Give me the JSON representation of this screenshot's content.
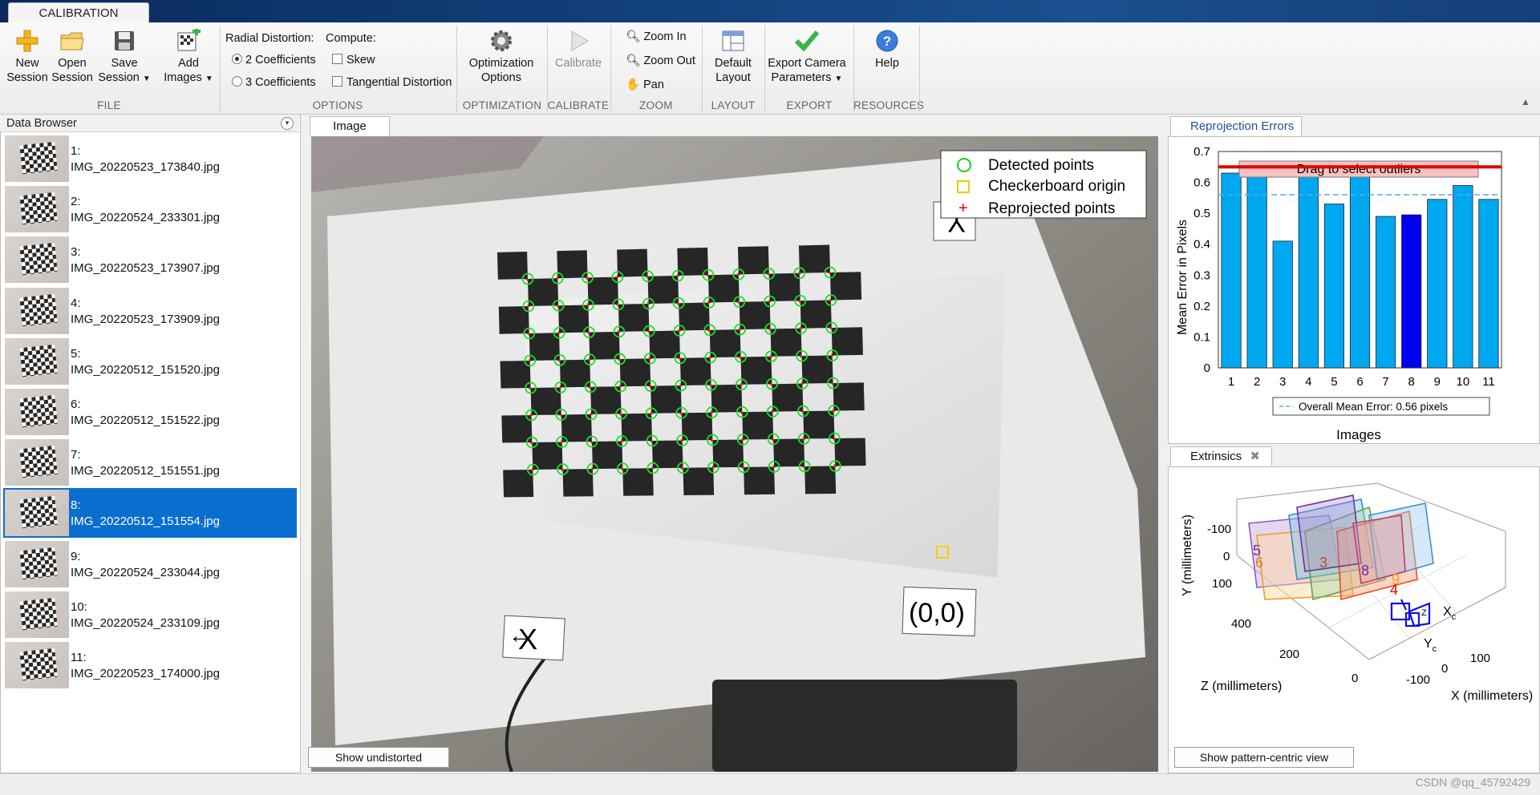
{
  "ribbon": {
    "tab": "CALIBRATION",
    "file": {
      "new_session": [
        "New",
        "Session"
      ],
      "open_session": [
        "Open",
        "Session"
      ],
      "save_session": [
        "Save",
        "Session"
      ],
      "add_images": [
        "Add",
        "Images"
      ],
      "section": "FILE"
    },
    "options": {
      "radial_label": "Radial Distortion:",
      "radial_options": [
        "2 Coefficients",
        "3 Coefficients"
      ],
      "radial_selected": "2 Coefficients",
      "compute_label": "Compute:",
      "compute_options": [
        "Skew",
        "Tangential Distortion"
      ],
      "section": "OPTIONS"
    },
    "optimization": {
      "label": [
        "Optimization",
        "Options"
      ],
      "section": "OPTIMIZATION"
    },
    "calibrate": {
      "label": "Calibrate",
      "section": "CALIBRATE"
    },
    "zoom": {
      "zoom_in": "Zoom In",
      "zoom_out": "Zoom Out",
      "pan": "Pan",
      "section": "ZOOM"
    },
    "layout": {
      "label": [
        "Default",
        "Layout"
      ],
      "section": "LAYOUT"
    },
    "export": {
      "label": [
        "Export Camera",
        "Parameters"
      ],
      "section": "EXPORT"
    },
    "resources": {
      "label": "Help",
      "section": "RESOURCES"
    }
  },
  "data_browser": {
    "title": "Data Browser",
    "selected_index": 8,
    "items": [
      {
        "num": "1:",
        "name": "IMG_20220523_173840.jpg"
      },
      {
        "num": "2:",
        "name": "IMG_20220524_233301.jpg"
      },
      {
        "num": "3:",
        "name": "IMG_20220523_173907.jpg"
      },
      {
        "num": "4:",
        "name": "IMG_20220523_173909.jpg"
      },
      {
        "num": "5:",
        "name": "IMG_20220512_151520.jpg"
      },
      {
        "num": "6:",
        "name": "IMG_20220512_151522.jpg"
      },
      {
        "num": "7:",
        "name": "IMG_20220512_151551.jpg"
      },
      {
        "num": "8:",
        "name": "IMG_20220512_151554.jpg"
      },
      {
        "num": "9:",
        "name": "IMG_20220524_233044.jpg"
      },
      {
        "num": "10:",
        "name": "IMG_20220524_233109.jpg"
      },
      {
        "num": "11:",
        "name": "IMG_20220523_174000.jpg"
      }
    ]
  },
  "image_panel": {
    "tab": "Image",
    "legend": [
      "Detected points",
      "Checkerboard origin",
      "Reprojected points"
    ],
    "axis_x_label": "X",
    "axis_y_label": "Y",
    "origin_label": "(0,0)",
    "show_undistorted": "Show undistorted"
  },
  "reprojection_panel": {
    "tab": "Reprojection Errors",
    "drag_label": "Drag to select outliers"
  },
  "extrinsics_panel": {
    "tab": "Extrinsics",
    "ylabel": "Y (millimeters)",
    "zlabel": "Z (millimeters)",
    "xlabel": "X (millimeters)",
    "y_ticks": [
      "-100",
      "0",
      "100"
    ],
    "z_ticks": [
      "400",
      "200",
      "0"
    ],
    "x_ticks": [
      "-100",
      "0",
      "100"
    ],
    "camera_x": "X",
    "camera_y": "Y",
    "camera_z": "Z",
    "camera_sub": "c",
    "plane_labels": [
      "5",
      "6",
      "3",
      "8",
      "4",
      "9"
    ],
    "show_pattern_centric": "Show pattern-centric view"
  },
  "chart_data": {
    "type": "bar",
    "categories": [
      "1",
      "2",
      "3",
      "4",
      "5",
      "6",
      "7",
      "8",
      "9",
      "10",
      "11"
    ],
    "values": [
      0.63,
      0.625,
      0.41,
      0.65,
      0.53,
      0.63,
      0.49,
      0.495,
      0.545,
      0.59,
      0.545
    ],
    "highlight_index": 7,
    "xlabel": "Images",
    "ylabel": "Mean Error in Pixels",
    "ylim": [
      0,
      0.7
    ],
    "yticks": [
      "0",
      "0.1",
      "0.2",
      "0.3",
      "0.4",
      "0.5",
      "0.6",
      "0.7"
    ],
    "mean_line": 0.56,
    "mean_label": "Overall Mean Error: 0.56 pixels",
    "threshold_line": 0.65,
    "colors": {
      "bar": "#00a8f0",
      "highlight": "#0000ee",
      "threshold": "#e00000",
      "mean": "#55aaee"
    }
  },
  "watermark": "CSDN @qq_45792429"
}
